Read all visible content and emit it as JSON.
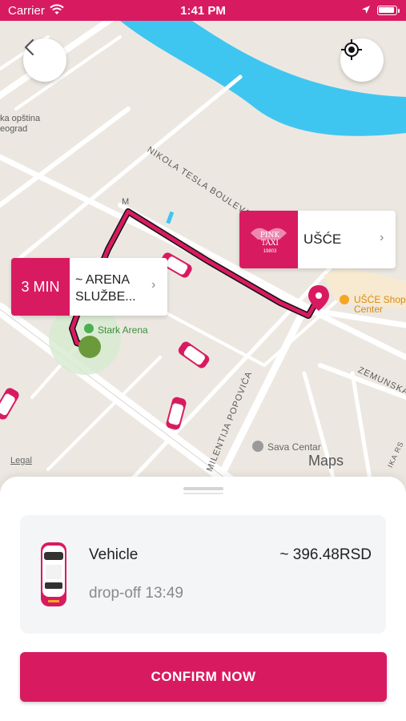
{
  "status_bar": {
    "carrier": "Carrier",
    "time": "1:41 PM"
  },
  "map": {
    "street_labels": [
      "NIKOLA TESLA BOULEVARD",
      "MILENTIJA POPOVIĆA",
      "ZEMUNSKA",
      "ka opština",
      "eograd",
      "M",
      "IKA RS"
    ],
    "poi_labels": {
      "stark_arena": "Stark Arena",
      "sava_centar": "Sava Centar",
      "usce_shop": "UŠĆE Shop",
      "usce_center": "Center"
    },
    "legal": "Legal",
    "maps_brand": "Maps",
    "colors": {
      "route": "#d81b60",
      "water": "#3fc6f0",
      "land": "#ece8e1",
      "road": "#ffffff"
    }
  },
  "destination_card": {
    "logo_text": "PINK TAXI",
    "logo_sub": "19803",
    "name": "UŠĆE"
  },
  "eta_card": {
    "eta": "3 MIN",
    "name": "~ ARENA SLUŽBE..."
  },
  "vehicle": {
    "name": "Vehicle",
    "price": "~ 396.48RSD",
    "dropoff": "drop-off 13:49"
  },
  "confirm_label": "CONFIRM NOW",
  "accent_color": "#d81b60"
}
